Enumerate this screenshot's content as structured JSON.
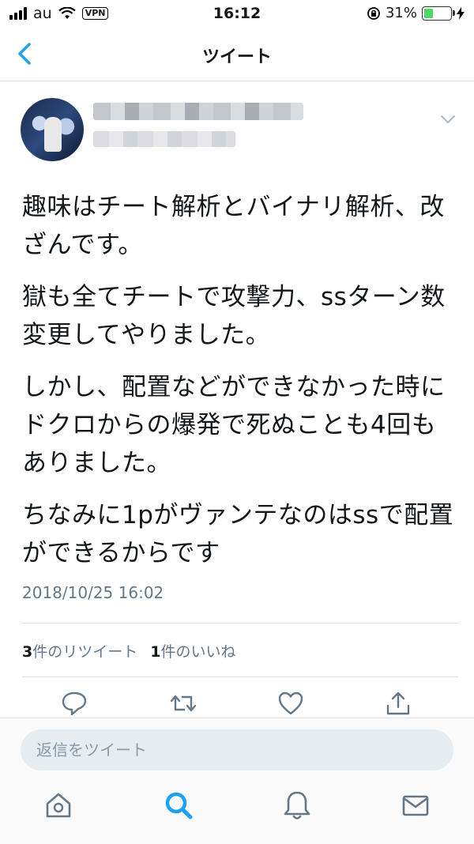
{
  "status_bar": {
    "carrier": "au",
    "vpn": "VPN",
    "time": "16:12",
    "battery": "31%",
    "battery_level": 0.31
  },
  "nav": {
    "title": "ツイート",
    "back_icon": "chevron-left-icon"
  },
  "tweet": {
    "menu_icon": "chevron-down-icon",
    "paragraphs": [
      "趣味はチート解析とバイナリ解析、改ざんです。",
      "獄も全てチートで攻撃力、ssターン数変更してやりました。",
      "しかし、配置などができなかった時にドクロからの爆発で死ぬことも4回もありました。",
      "ちなみに1pがヴァンテなのはssで配置ができるからです"
    ],
    "timestamp": "2018/10/25 16:02",
    "stats": {
      "retweet_count": "3",
      "retweet_label": "件のリツイート",
      "like_count": "1",
      "like_label": "件のいいね"
    },
    "actions": [
      "reply-icon",
      "retweet-icon",
      "like-icon",
      "share-icon"
    ]
  },
  "reply": {
    "placeholder": "返信をツイート"
  },
  "tabbar": [
    "home-icon",
    "search-icon",
    "notifications-icon",
    "messages-icon"
  ],
  "colors": {
    "accent": "#1da1f2",
    "icon_gray": "#657786",
    "text": "#14171a",
    "battery_green": "#4cd964"
  }
}
